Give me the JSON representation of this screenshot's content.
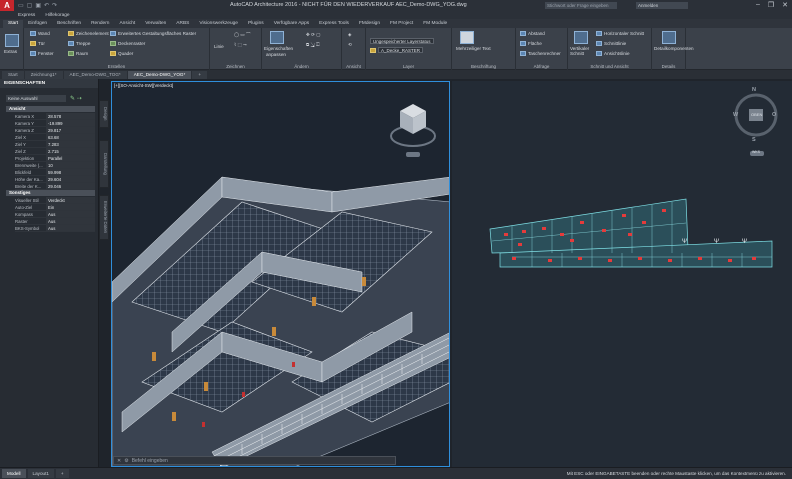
{
  "app": {
    "logo": "A",
    "title": "AutoCAD Architecture 2016 - NICHT FÜR DEN WIEDERVERKAUF   AEC_Demo-DWG_YOG.dwg",
    "search_placeholder": "Stichwort oder Frage eingeben",
    "signin": "Anmelden",
    "win_controls": [
      "–",
      "❐",
      "✕"
    ]
  },
  "menubar": [
    "Express",
    "Hilfekorage"
  ],
  "ribbon_tabs": [
    "Start",
    "Einfügen",
    "Beschriften",
    "Rendern",
    "Ansicht",
    "Verwalten",
    "ARBS",
    "Visionswerkzeuge",
    "Plugins",
    "Verfügbare Apps",
    "Express Tools",
    "FMdesign",
    "FM Project",
    "FM Module"
  ],
  "active_ribbon_tab": "Start",
  "ribbon": {
    "extras": {
      "label": "Extras"
    },
    "erstellen": {
      "title": "Erstellen",
      "items": [
        "Wand",
        "Zeichenelement",
        "Erweitertes Gestaltungsfläches Raster",
        "Tür",
        "Treppe",
        "Deckenraster",
        "Fenster",
        "Raum",
        "Quader"
      ]
    },
    "zeichnen": {
      "title": "Zeichnen",
      "linie": "Linie"
    },
    "aendern": {
      "title": "Ändern",
      "eigenschaften": "Eigenschaften",
      "uebertragen": "anpassen"
    },
    "ansicht": {
      "title": "Ansicht"
    },
    "layer": {
      "title": "Layer",
      "combo1": "Ungespeicherter Layerstatus",
      "combo2": "A_Decke_RASTER"
    },
    "beschriftung": {
      "title": "Beschriftung",
      "text": "Mehrzeiliger Text"
    },
    "abfrage": {
      "title": "Abfrage",
      "items": [
        "Abstand",
        "Fläche",
        "Taschenrechner"
      ]
    },
    "schnitt": {
      "title": "Schnitt und Ansicht",
      "vertical": "Vertikaler Schnitt",
      "items": [
        "Horizontaler Schnitt",
        "Schnittlinie",
        "Ansichtslinie"
      ]
    },
    "details": {
      "title": "Details",
      "label": "Detailkomponenten"
    }
  },
  "doc_tabs": [
    "Start",
    "Zeichnung1*",
    "AEC_Demo-DWG_TOG*",
    "AEC_Demo-DWG_YOG*"
  ],
  "active_doc_tab": "AEC_Demo-DWG_YOG*",
  "props": {
    "title": "EIGENSCHAFTEN",
    "selection": "Keine Auswahl",
    "section1": "Ansicht",
    "rows1": [
      {
        "k": "Kamera X",
        "v": "28.578"
      },
      {
        "k": "Kamera Y",
        "v": "-19.899"
      },
      {
        "k": "Kamera Z",
        "v": "29.817"
      },
      {
        "k": "Ziel X",
        "v": "63.68"
      },
      {
        "k": "Ziel Y",
        "v": "7.283"
      },
      {
        "k": "Ziel Z",
        "v": "2.715"
      },
      {
        "k": "Projektion",
        "v": "Parallel"
      },
      {
        "k": "Brennweite (...",
        "v": "10"
      },
      {
        "k": "Blickfeld",
        "v": "59.998"
      },
      {
        "k": "Höhe der Ka...",
        "v": "29.604"
      },
      {
        "k": "Breite der K...",
        "v": "29.046"
      }
    ],
    "section2": "Sonstiges",
    "rows2": [
      {
        "k": "Visueller Stil",
        "v": "Verdeckt"
      },
      {
        "k": "Auto-Ziel",
        "v": "Ein"
      },
      {
        "k": "Kompass",
        "v": "Aus"
      },
      {
        "k": "Raster",
        "v": "Aus"
      },
      {
        "k": "BKS-Symbol",
        "v": "Aus"
      }
    ],
    "vtabs": [
      "Design",
      "Darstellung",
      "Erweiterte Daten"
    ]
  },
  "viewport_left": {
    "label": "[+][SO-Ansicht-SW][Verdeckt]"
  },
  "viewcube": {
    "top": "OBEN",
    "n": "N",
    "s": "S",
    "w": "W",
    "o": "O",
    "wcs": "WKS"
  },
  "cmdline": {
    "placeholder": "Befehl eingeben"
  },
  "status": {
    "tabs": [
      "Modell",
      "Layout1",
      "+"
    ],
    "message": "Mit ESC oder EINGABETASTE beenden oder rechte Maustaste klicken, um das Kontextmenü zu aktivieren."
  },
  "colors": {
    "accent": "#2f8fdc",
    "brand": "#c6262c"
  }
}
